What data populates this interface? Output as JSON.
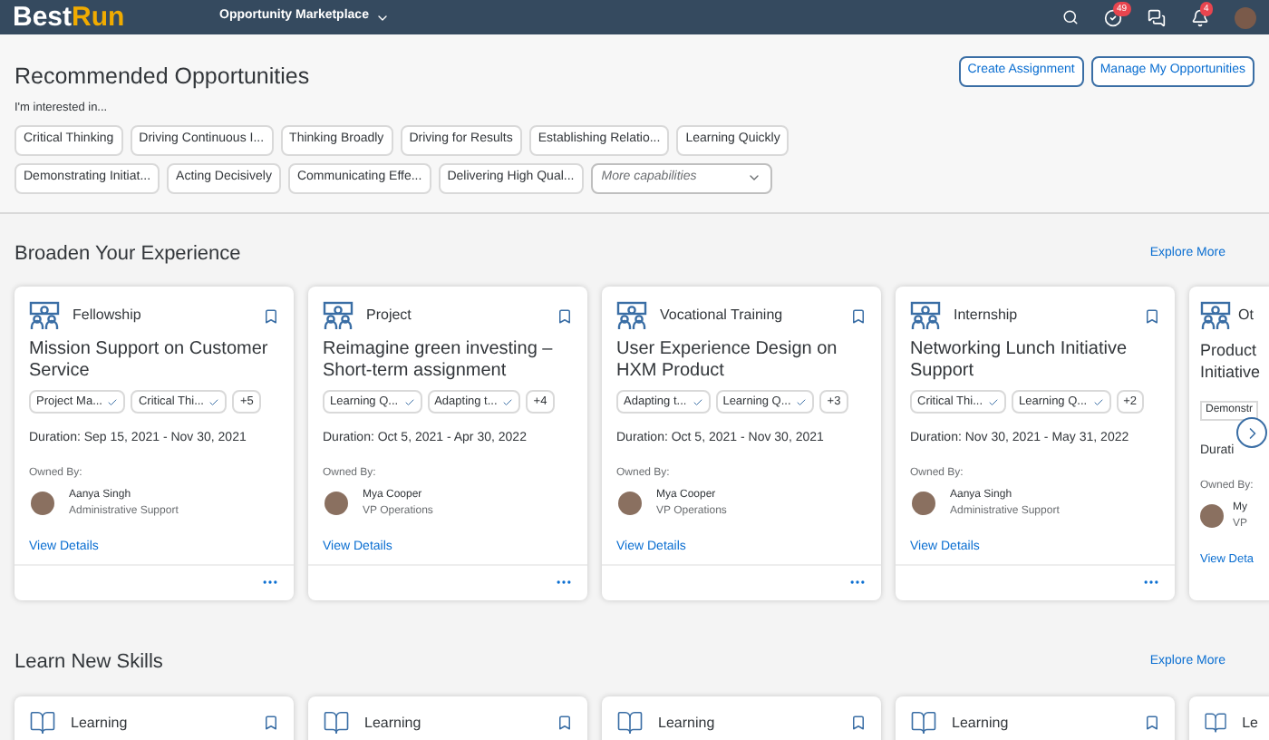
{
  "shell": {
    "logo_part_1": "Best",
    "logo_part_2": "Run",
    "menu_title": "Opportunity Marketplace",
    "tasks_badge": "49",
    "notifications_badge": "4"
  },
  "recommended": {
    "title": "Recommended Opportunities",
    "buttons": [
      "Create Assignment",
      "Manage My Opportunities"
    ],
    "interest_label": "I'm interested in...",
    "chip_rows": [
      [
        "Critical Thinking",
        "Driving Continuous I...",
        "Thinking Broadly",
        "Driving for Results",
        "Establishing Relatio...",
        "Learning Quickly"
      ],
      [
        "Demonstrating Initiat...",
        "Acting Decisively",
        "Communicating Effe...",
        "Delivering High Qual..."
      ]
    ],
    "capabilities": {
      "placeholder": "More capabilities"
    }
  },
  "broaden": {
    "title": "Broaden Your Experience",
    "link": "Explore More",
    "cards": [
      {
        "type": "Fellowship",
        "title": "Mission Support on Customer Service",
        "tags": [
          "Project Ma...",
          "Critical Thi..."
        ],
        "more": "+5",
        "duration": "Duration: Sep 15, 2021 - Nov 30, 2021",
        "owned_label": "Owned By:",
        "owner": "Aanya Singh",
        "role": "Administrative Support",
        "link": "View Details"
      },
      {
        "type": "Project",
        "title": "Reimagine green investing – Short-term assignment",
        "tags": [
          "Learning Q...",
          "Adapting t..."
        ],
        "more": "+4",
        "duration": "Duration: Oct 5, 2021 - Apr 30, 2022",
        "owned_label": "Owned By:",
        "owner": "Mya Cooper",
        "role": "VP Operations",
        "link": "View Details"
      },
      {
        "type": "Vocational Training",
        "title": "User Experience Design on HXM Product",
        "tags": [
          "Adapting t...",
          "Learning Q..."
        ],
        "more": "+3",
        "duration": "Duration: Oct 5, 2021 - Nov 30, 2021",
        "owned_label": "Owned By:",
        "owner": "Mya Cooper",
        "role": "VP Operations",
        "link": "View Details"
      },
      {
        "type": "Internship",
        "title": "Networking Lunch Initiative Support",
        "tags": [
          "Critical Thi...",
          "Learning Q..."
        ],
        "more": "+2",
        "duration": "Duration: Nov 30, 2021 - May 31, 2022",
        "owned_label": "Owned By:",
        "owner": "Aanya Singh",
        "role": "Administrative Support",
        "link": "View Details"
      }
    ],
    "partial_card": {
      "type": "Ot",
      "title_line_1": "Product",
      "title_line_2": "Initiative",
      "tag": "Demonstr",
      "duration": "Durati",
      "owned_label": "Owned By:",
      "owner": "My",
      "role": "VP",
      "link": "View Deta"
    }
  },
  "learn": {
    "title": "Learn New Skills",
    "link": "Explore More",
    "cards": [
      {
        "type": "Learning"
      },
      {
        "type": "Learning"
      },
      {
        "type": "Learning"
      },
      {
        "type": "Learning"
      }
    ],
    "partial_card": {
      "type": "Le"
    }
  }
}
